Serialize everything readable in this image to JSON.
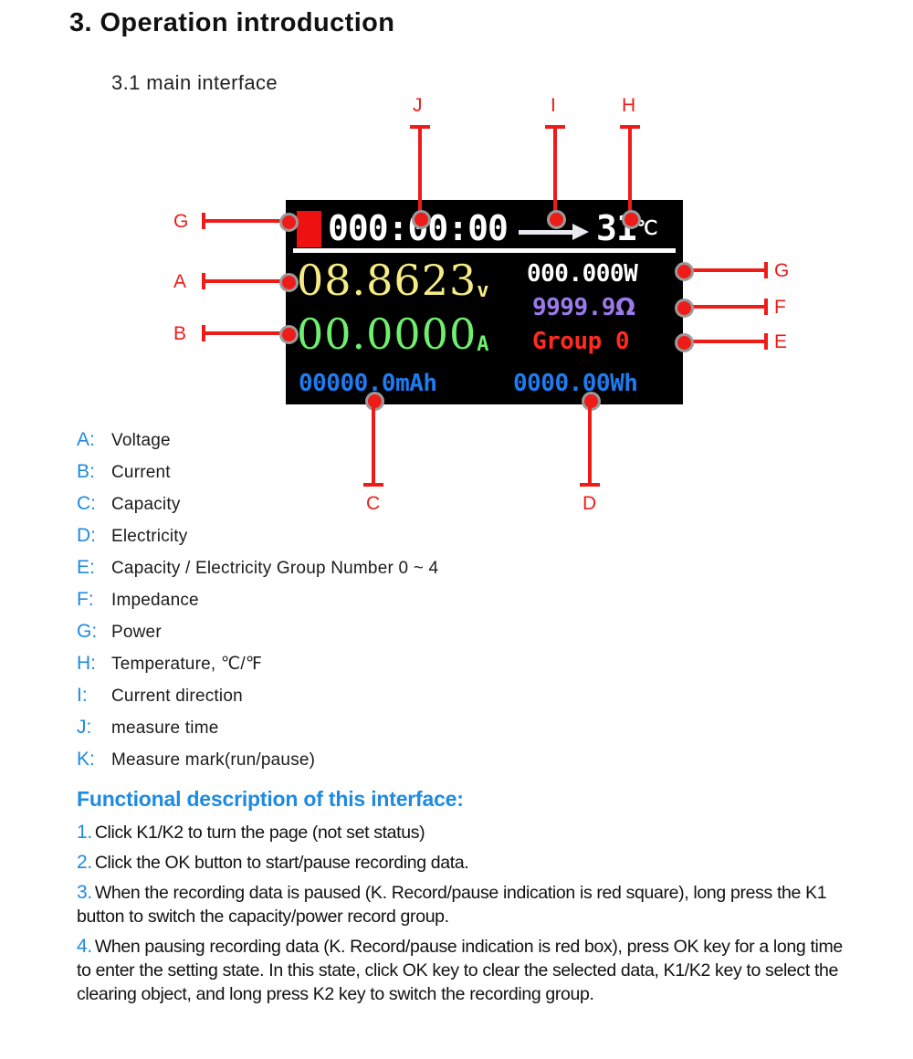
{
  "document": {
    "section_heading": "3. Operation introduction",
    "subsection_heading": "3.1 main interface"
  },
  "lcd": {
    "record_mark": {
      "name": "run-pause-mark",
      "state": "paused",
      "color": "#ee1111"
    },
    "measure_time": "000:00:00",
    "current_direction_icon": "arrow-right-icon",
    "temperature": "31",
    "temperature_unit": "℃",
    "voltage_value": "08.8623",
    "voltage_unit": "v",
    "voltage_color": "#f5ec84",
    "current_value": "00.0000",
    "current_unit": "A",
    "current_color": "#6ef06e",
    "power": "000.000W",
    "power_color": "#ffffff",
    "impedance_value": "9999.9",
    "impedance_unit": "Ω",
    "impedance_color": "#9b7aea",
    "group": "Group 0",
    "group_color": "#ff2a20",
    "capacity": "00000.0mAh",
    "electricity": "0000.00Wh",
    "bottom_color": "#1e7bf0"
  },
  "callouts": {
    "j": "J",
    "i": "I",
    "h": "H",
    "g_left": "G",
    "a": "A",
    "b": "B",
    "g_right": "G",
    "f": "F",
    "e": "E",
    "c": "C",
    "d": "D"
  },
  "legend": [
    {
      "key": "A:",
      "text": "Voltage"
    },
    {
      "key": "B:",
      "text": "Current"
    },
    {
      "key": "C:",
      "text": "Capacity"
    },
    {
      "key": "D:",
      "text": "Electricity"
    },
    {
      "key": "E:",
      "text": "Capacity / Electricity Group Number 0 ~ 4"
    },
    {
      "key": "F:",
      "text": "Impedance"
    },
    {
      "key": "G:",
      "text": "Power"
    },
    {
      "key": "H:",
      "text": "Temperature, ℃/℉"
    },
    {
      "key": "I:",
      "text": "Current direction"
    },
    {
      "key": "J:",
      "text": "measure time"
    },
    {
      "key": "K:",
      "text": "Measure mark(run/pause)"
    }
  ],
  "functional_description": {
    "title": "Functional description of this interface:",
    "items": [
      {
        "num": "1.",
        "text": "Click K1/K2 to turn the page (not set status)"
      },
      {
        "num": "2.",
        "text": "Click the OK button to start/pause recording data."
      },
      {
        "num": "3.",
        "text": "When the recording data is paused (K. Record/pause indication is red square), long press the K1 button to switch the capacity/power record group."
      },
      {
        "num": "4.",
        "text": "When pausing recording data (K. Record/pause indication is red box), press OK key for a long time to enter the setting state. In this state, click OK key to clear the selected data, K1/K2 key to select the clearing object, and long press K2 key to switch the recording group."
      }
    ]
  },
  "colors": {
    "accent_blue": "#1f8ae0",
    "callout_red": "#ee1c19",
    "lcd_background": "#000000"
  }
}
